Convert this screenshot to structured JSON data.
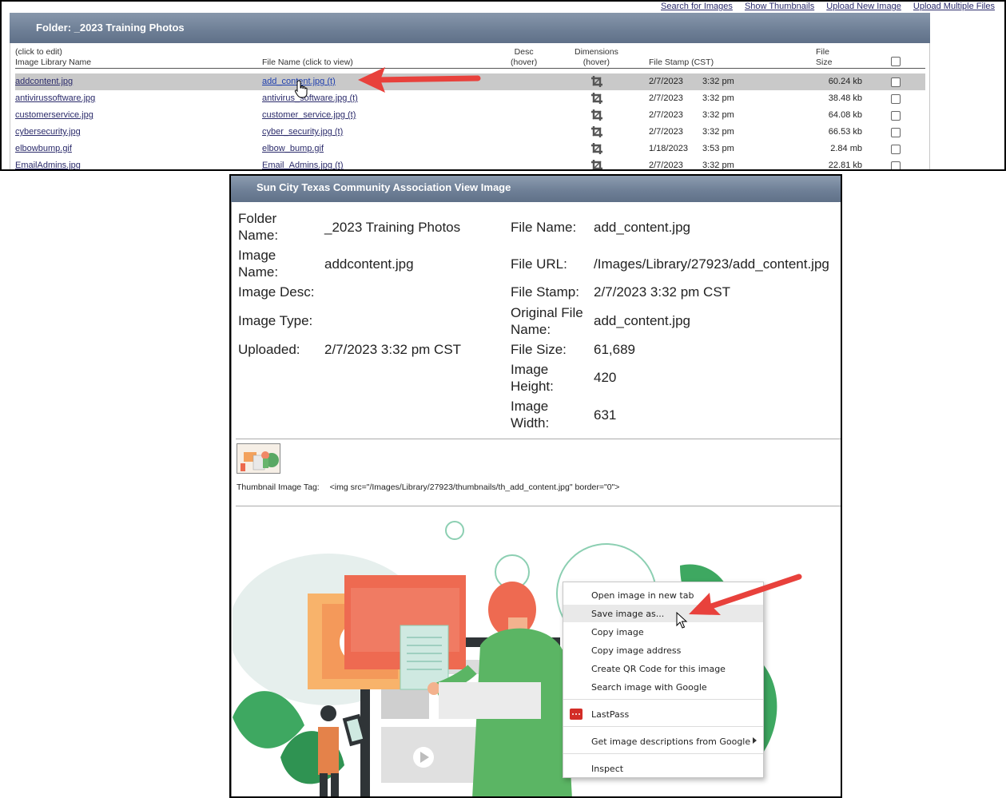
{
  "top_links": [
    "Search for Images",
    "Show Thumbnails",
    "Upload New Image",
    "Upload Multiple Files"
  ],
  "folder_header": "Folder: _2023 Training Photos",
  "columns": {
    "name_line1": "(click to edit)",
    "name_line2": "Image Library Name",
    "file": "File Name (click to view)",
    "desc_line1": "Desc",
    "desc_line2": "(hover)",
    "dim_line1": "Dimensions",
    "dim_line2": "(hover)",
    "stamp": "File Stamp (CST)",
    "size_line1": "File",
    "size_line2": "Size"
  },
  "rows": [
    {
      "name": "addcontent.jpg",
      "file": "add_content.jpg (t)",
      "date": "2/7/2023",
      "time": "3:32 pm",
      "size": "60.24 kb"
    },
    {
      "name": "antivirussoftware.jpg",
      "file": "antivirus_software.jpg (t)",
      "date": "2/7/2023",
      "time": "3:32 pm",
      "size": "38.48 kb"
    },
    {
      "name": "customerservice.jpg",
      "file": "customer_service.jpg (t)",
      "date": "2/7/2023",
      "time": "3:32 pm",
      "size": "64.08 kb"
    },
    {
      "name": "cybersecurity.jpg",
      "file": "cyber_security.jpg (t)",
      "date": "2/7/2023",
      "time": "3:32 pm",
      "size": "66.53 kb"
    },
    {
      "name": "elbowbump.gif",
      "file": "elbow_bump.gif",
      "date": "1/18/2023",
      "time": "3:53 pm",
      "size": "2.84 mb"
    },
    {
      "name": "EmailAdmins.jpg",
      "file": "Email_Admins.jpg (t)",
      "date": "2/7/2023",
      "time": "3:32 pm",
      "size": "22.81 kb"
    }
  ],
  "view": {
    "header": "Sun City Texas Community Association View Image",
    "left": {
      "folder_label": "Folder Name:",
      "folder_value": "_2023 Training Photos",
      "image_name_label": "Image Name:",
      "image_name_value": "addcontent.jpg",
      "desc_label": "Image Desc:",
      "type_label": "Image Type:",
      "uploaded_label": "Uploaded:",
      "uploaded_value": "2/7/2023 3:32 pm CST"
    },
    "right": {
      "file_name_label": "File Name:",
      "file_name_value": "add_content.jpg",
      "file_url_label": "File URL:",
      "file_url_value": "/Images/Library/27923/add_content.jpg",
      "stamp_label": "File Stamp:",
      "stamp_value": "2/7/2023 3:32 pm CST",
      "orig_label": "Original File Name:",
      "orig_value": "add_content.jpg",
      "size_label": "File Size:",
      "size_value": "61,689",
      "height_label": "Image Height:",
      "height_value": "420",
      "width_label": "Image Width:",
      "width_value": "631"
    },
    "thumb_tag_label": "Thumbnail Image Tag:",
    "thumb_tag_value": "<img src=\"/Images/Library/27923/thumbnails/th_add_content.jpg\" border=\"0\">"
  },
  "context_menu": {
    "items": [
      "Open image in new tab",
      "Save image as...",
      "Copy image",
      "Copy image address",
      "Create QR Code for this image",
      "Search image with Google"
    ],
    "lastpass": "LastPass",
    "descriptions": "Get image descriptions from Google",
    "inspect": "Inspect"
  },
  "colors": {
    "header_gradient_top": "#8c9cb0",
    "header_gradient_bottom": "#5f7088",
    "link": "#2b2b6b",
    "selected_row": "#c9c9c9",
    "annotation_arrow": "#e8413c",
    "lastpass_red": "#d32d27"
  },
  "icons": {
    "dimensions": "crop-icon",
    "cursor_hand": "hand-pointer-icon",
    "cursor_arrow": "arrow-pointer-icon",
    "submenu": "chevron-right-icon"
  }
}
